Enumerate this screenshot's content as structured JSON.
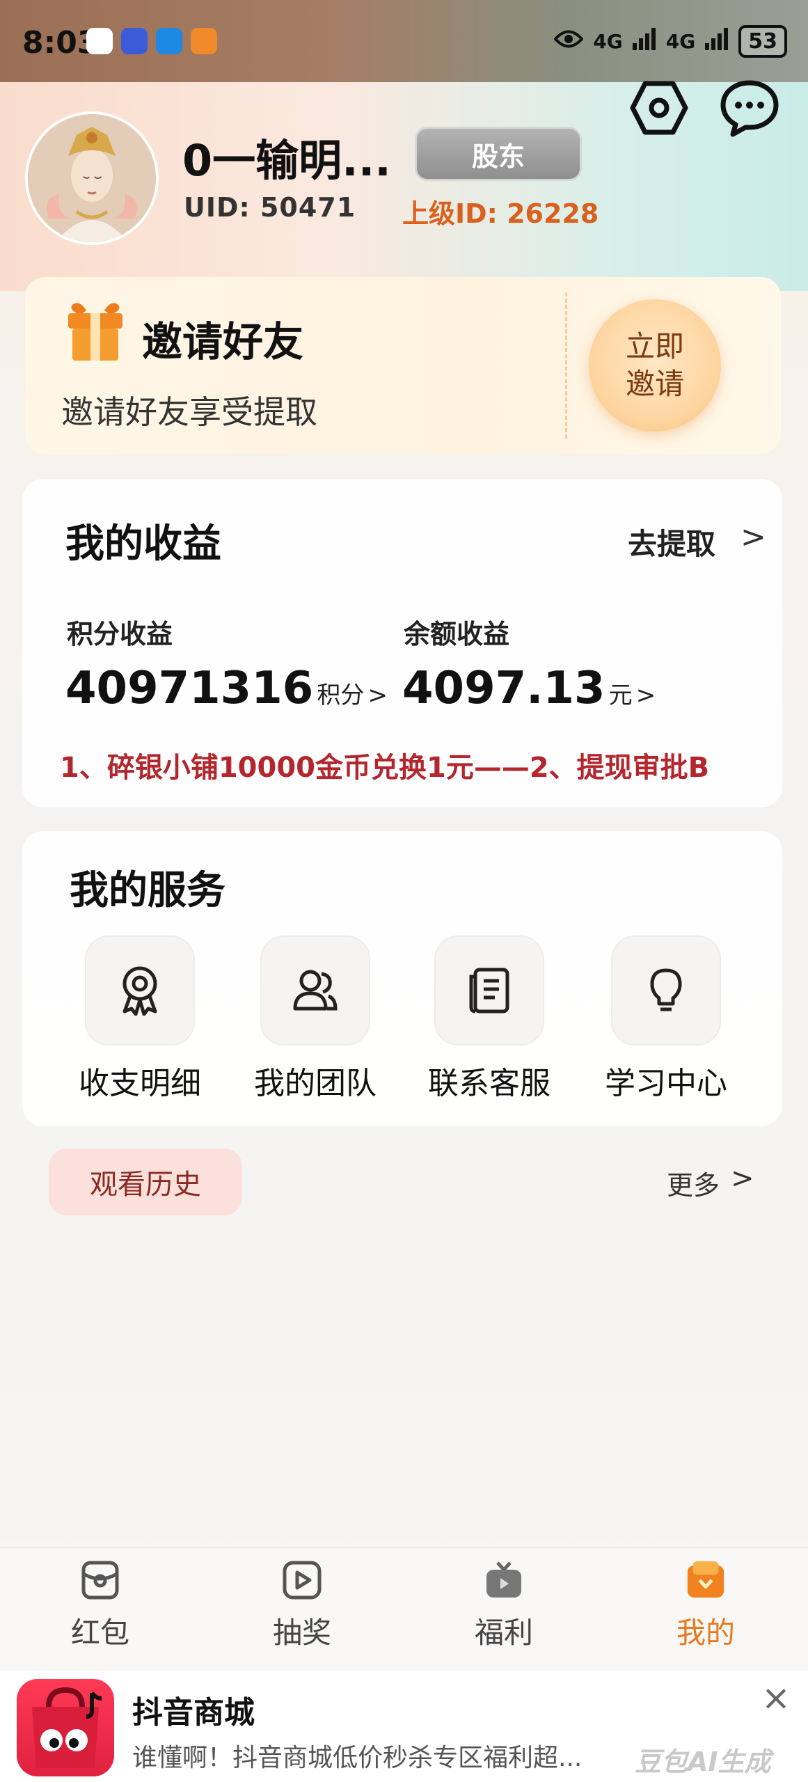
{
  "status_bar": {
    "time": "8:03",
    "network_1": "4G",
    "network_2": "4G",
    "battery": "53"
  },
  "profile": {
    "username": "0一输明...",
    "role_badge": "股东",
    "uid": "UID: 50471",
    "parent_id": "上级ID: 26228"
  },
  "invite": {
    "title": "邀请好友",
    "subtitle": "邀请好友享受提取",
    "button_line1": "立即",
    "button_line2": "邀请"
  },
  "earnings": {
    "title": "我的收益",
    "withdraw_label": "去提取",
    "withdraw_chevron": ">",
    "points_label": "积分收益",
    "points_value": "40971316",
    "points_unit": "积分",
    "points_chevron": ">",
    "balance_label": "余额收益",
    "balance_value": "4097.13",
    "balance_unit": "元",
    "balance_chevron": ">",
    "notice": "1、碎银小铺10000金币兑换1元——2、提现审批B"
  },
  "services": {
    "title": "我的服务",
    "items": [
      {
        "label": "收支明细",
        "icon": "medal-icon"
      },
      {
        "label": "我的团队",
        "icon": "team-icon"
      },
      {
        "label": "联系客服",
        "icon": "document-icon"
      },
      {
        "label": "学习中心",
        "icon": "lightbulb-icon"
      }
    ]
  },
  "history": {
    "tab_label": "观看历史",
    "more_label": "更多",
    "more_chevron": ">"
  },
  "bottom_nav": {
    "items": [
      {
        "label": "红包",
        "icon": "red-packet-icon",
        "active": false
      },
      {
        "label": "抽奖",
        "icon": "play-icon",
        "active": false
      },
      {
        "label": "福利",
        "icon": "tv-icon",
        "active": false
      },
      {
        "label": "我的",
        "icon": "profile-icon",
        "active": true
      }
    ]
  },
  "ad": {
    "title": "抖音商城",
    "description": "谁懂啊！抖音商城低价秒杀专区福利超...",
    "close": "×",
    "watermark": "豆包AI生成"
  },
  "colors": {
    "accent_orange": "#e8791d",
    "notice_red": "#b3262d",
    "parent_id_orange": "#d9611d"
  }
}
